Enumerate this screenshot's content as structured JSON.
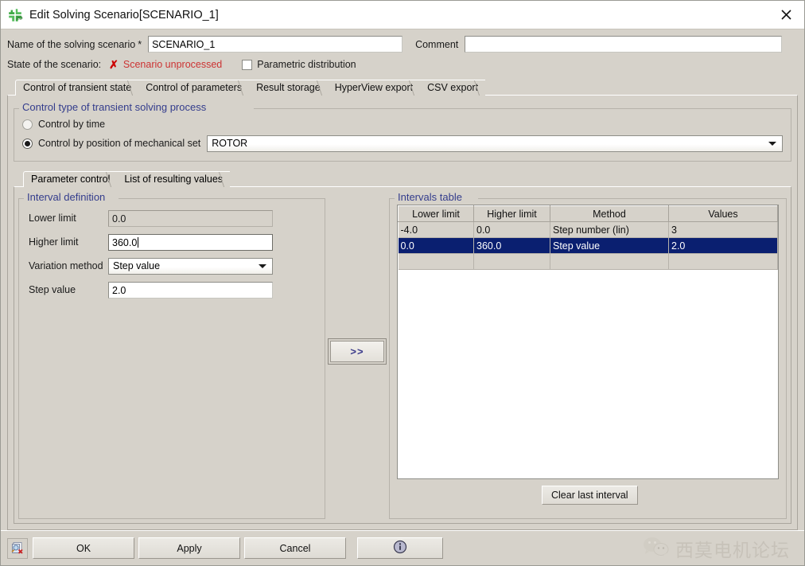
{
  "window": {
    "title": "Edit Solving Scenario[SCENARIO_1]",
    "app_icon": "flux2d-pinwheel-icon",
    "close_icon": "close-icon"
  },
  "header": {
    "name_label": "Name of the solving scenario",
    "required_marker": "*",
    "name_value": "SCENARIO_1",
    "comment_label": "Comment",
    "comment_value": "",
    "comment_placeholder": "",
    "state_label": "State of the scenario:",
    "state_icon": "red-x-icon",
    "state_value": "Scenario unprocessed",
    "state_color": "#cc3333",
    "parametric_checkbox_label": "Parametric distribution",
    "parametric_checked": false
  },
  "tabs": [
    {
      "label": "Control of transient state",
      "selected": true
    },
    {
      "label": "Control of parameters",
      "selected": false
    },
    {
      "label": "Result storage",
      "selected": false
    },
    {
      "label": "HyperView export",
      "selected": false
    },
    {
      "label": "CSV export",
      "selected": false
    }
  ],
  "control_type_group": {
    "title": "Control type of transient solving process",
    "title_color": "#333c8c",
    "options": [
      {
        "label": "Control by time",
        "selected": false
      },
      {
        "label": "Control by position of mechanical set",
        "selected": true
      }
    ],
    "mechanical_set_value": "ROTOR",
    "dropdown_icon": "chevron-down-icon"
  },
  "inner_tabs": [
    {
      "label": "Parameter control",
      "selected": true
    },
    {
      "label": "List of resulting values",
      "selected": false
    }
  ],
  "interval_definition": {
    "title": "Interval definition",
    "fields": [
      {
        "label": "Lower limit",
        "value": "0.0",
        "type": "readonly-text"
      },
      {
        "label": "Higher limit",
        "value": "360.0",
        "type": "text-focused"
      },
      {
        "label": "Variation method",
        "value": "Step value",
        "type": "combo"
      },
      {
        "label": "Step value",
        "value": "2.0",
        "type": "text"
      }
    ]
  },
  "transfer_button": {
    "label": ">>",
    "name": "transfer-to-table-button"
  },
  "intervals_table": {
    "title": "Intervals table",
    "columns": [
      "Lower limit",
      "Higher limit",
      "Method",
      "Values"
    ],
    "rows": [
      {
        "cells": [
          "-4.0",
          "0.0",
          "Step number (lin)",
          "3"
        ],
        "selected": false
      },
      {
        "cells": [
          "0.0",
          "360.0",
          "Step value",
          "2.0"
        ],
        "selected": true
      },
      {
        "cells": [
          "",
          "",
          "",
          ""
        ],
        "selected": false
      }
    ],
    "clear_button_label": "Clear last interval",
    "selection_color": "#0a1f70"
  },
  "bottom_bar": {
    "status_icon": "document-search-error-icon",
    "buttons": [
      {
        "label": "OK",
        "name": "ok-button"
      },
      {
        "label": "Apply",
        "name": "apply-button"
      },
      {
        "label": "Cancel",
        "name": "cancel-button"
      }
    ],
    "info_icon": "info-icon",
    "watermark": {
      "icon": "wechat-icon",
      "text": "西莫电机论坛"
    }
  }
}
